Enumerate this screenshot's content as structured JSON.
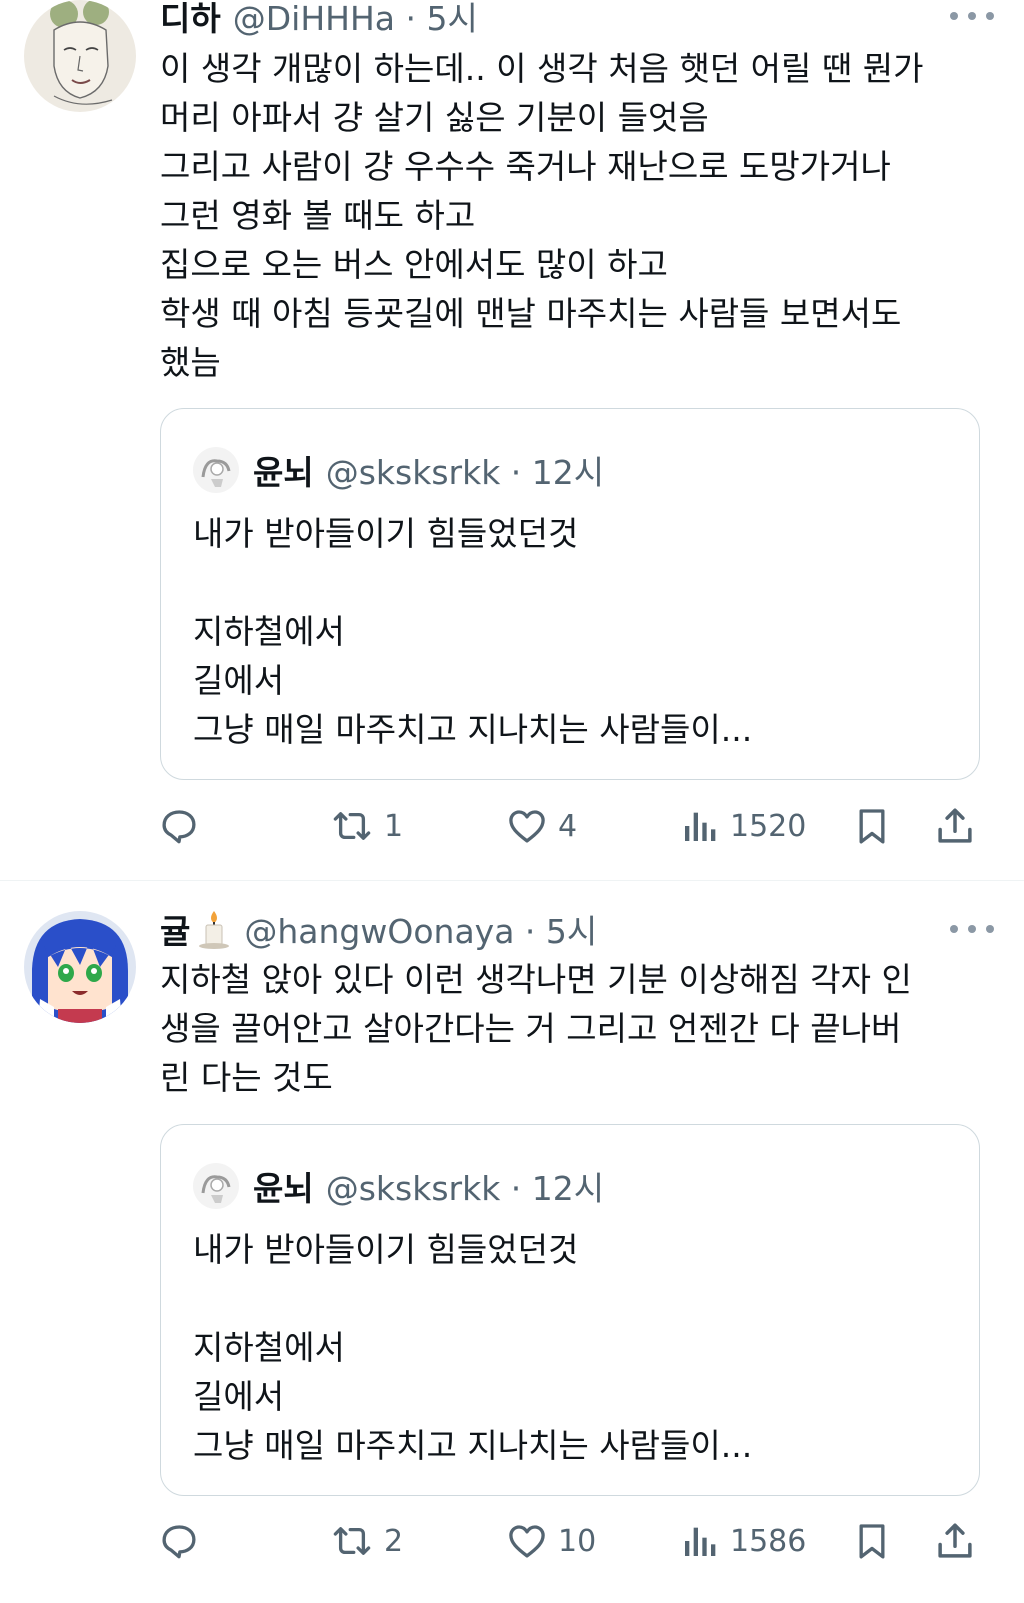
{
  "posts": [
    {
      "name": "디하",
      "handle": "@DiHHHa · 5시",
      "body_lines": [
        "이 생각 개많이 하는데.. 이 생각 처음 햇던 어릴 땐 뭔가",
        "머리 아파서 걍 살기 싫은 기분이 들엇음",
        "그리고 사람이 걍 우수수 죽거나 재난으로 도망가거나",
        "그런 영화 볼 때도 하고",
        "집으로 오는 버스 안에서도 많이 하고",
        "학생 때 아침 등굣길에 맨날 마주치는 사람들 보면서도",
        "했늠"
      ],
      "quote": {
        "name": "윤뇌",
        "handle": "@sksksrkk · 12시",
        "lines": [
          "내가 받아들이기 힘들었던것",
          "",
          "지하철에서",
          "길에서",
          "그냥 매일 마주치고 지나치는 사람들이..."
        ]
      },
      "stats": {
        "retweets": "1",
        "likes": "4",
        "views": "1520"
      }
    },
    {
      "name": "귤",
      "handle": "@hangwOonaya · 5시",
      "body_lines": [
        "지하철 앉아 있다 이런 생각나면 기분 이상해짐 각자 인",
        "생을 끌어안고 살아간다는 거 그리고 언젠간 다 끝나버",
        "린 다는 것도"
      ],
      "quote": {
        "name": "윤뇌",
        "handle": "@sksksrkk · 12시",
        "lines": [
          "내가 받아들이기 힘들었던것",
          "",
          "지하철에서",
          "길에서",
          "그냥 매일 마주치고 지나치는 사람들이..."
        ]
      },
      "stats": {
        "retweets": "2",
        "likes": "10",
        "views": "1586"
      }
    }
  ],
  "colors": {
    "text": "#0f1419",
    "muted": "#536471",
    "border": "#cfd9de"
  },
  "icons": [
    "reply-icon",
    "retweet-icon",
    "like-icon",
    "views-icon",
    "bookmark-icon",
    "share-icon",
    "more-icon",
    "candle-emoji"
  ]
}
